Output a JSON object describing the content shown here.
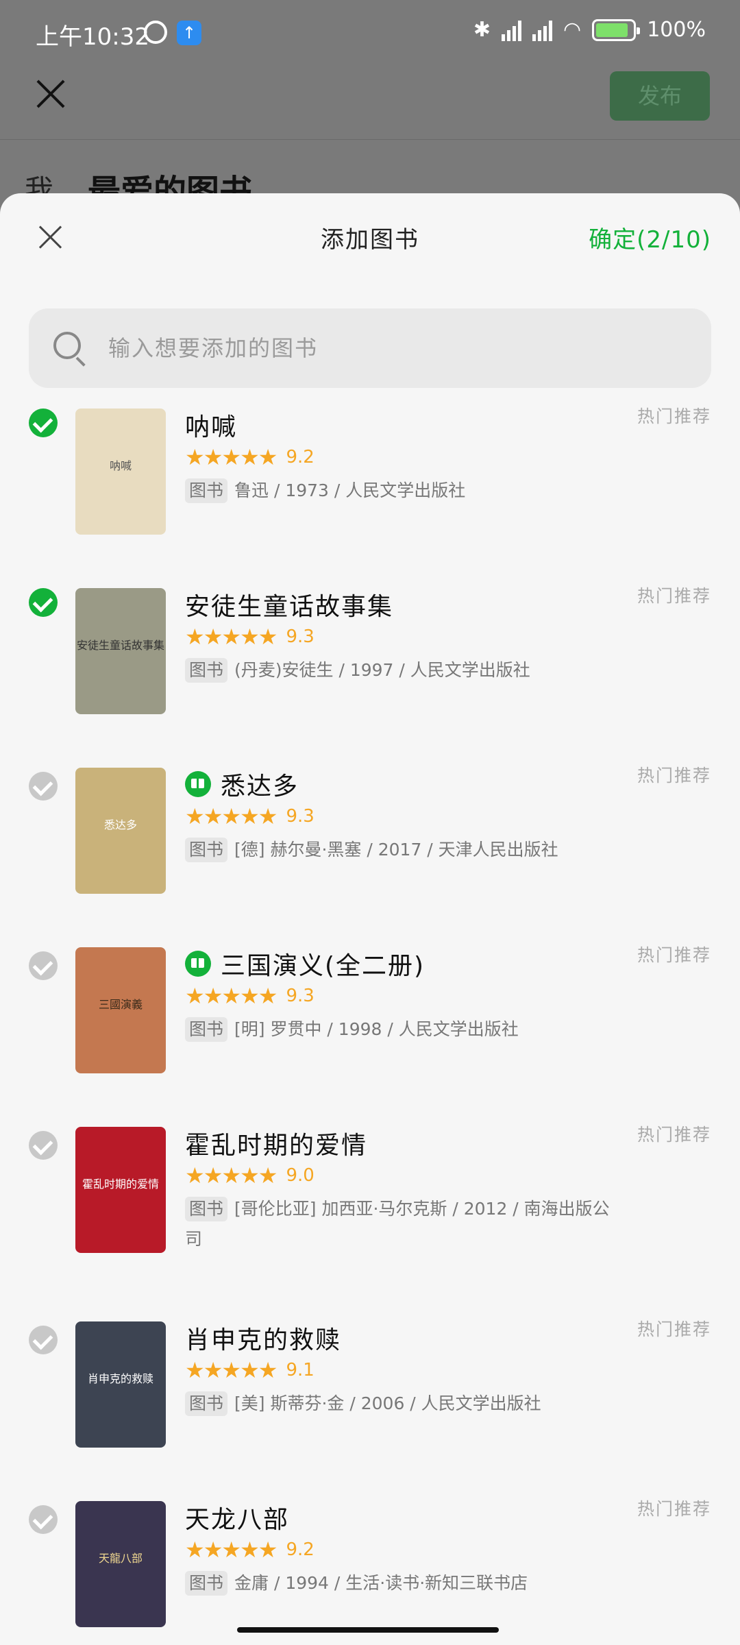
{
  "status_bar": {
    "time": "上午10:32",
    "battery": "100%"
  },
  "background_page": {
    "publish_label": "发布",
    "title": "最爱的图书",
    "title_icon": "我"
  },
  "sheet": {
    "title": "添加图书",
    "confirm_label": "确定(2/10)",
    "search_placeholder": "输入想要添加的图书"
  },
  "books": [
    {
      "title": "呐喊",
      "stars": "★★★★★",
      "rating": "9.2",
      "tag": "图书",
      "meta": "鲁迅 / 1973 / 人民文学出版社",
      "badge": "热门推荐",
      "selected": true,
      "readable": false
    },
    {
      "title": "安徒生童话故事集",
      "stars": "★★★★★",
      "rating": "9.3",
      "tag": "图书",
      "meta": "(丹麦)安徒生 / 1997 / 人民文学出版社",
      "badge": "热门推荐",
      "selected": true,
      "readable": false
    },
    {
      "title": "悉达多",
      "stars": "★★★★★",
      "rating": "9.3",
      "tag": "图书",
      "meta": "[德] 赫尔曼·黑塞 / 2017 / 天津人民出版社",
      "badge": "热门推荐",
      "selected": false,
      "readable": true
    },
    {
      "title": "三国演义(全二册)",
      "stars": "★★★★★",
      "rating": "9.3",
      "tag": "图书",
      "meta": "[明] 罗贯中 / 1998 / 人民文学出版社",
      "badge": "热门推荐",
      "selected": false,
      "readable": true
    },
    {
      "title": "霍乱时期的爱情",
      "stars": "★★★★★",
      "rating": "9.0",
      "tag": "图书",
      "meta": "[哥伦比亚] 加西亚·马尔克斯 / 2012 / 南海出版公司",
      "badge": "热门推荐",
      "selected": false,
      "readable": false
    },
    {
      "title": "肖申克的救赎",
      "stars": "★★★★★",
      "rating": "9.1",
      "tag": "图书",
      "meta": "[美] 斯蒂芬·金 / 2006 / 人民文学出版社",
      "badge": "热门推荐",
      "selected": false,
      "readable": false
    },
    {
      "title": "天龙八部",
      "stars": "★★★★★",
      "rating": "9.2",
      "tag": "图书",
      "meta": "金庸 / 1994 / 生活·读书·新知三联书店",
      "badge": "热门推荐",
      "selected": false,
      "readable": false
    }
  ],
  "covers": [
    {
      "text": "呐喊",
      "color": "#e8dcc0",
      "fg": "#555"
    },
    {
      "text": "安徒生童话故事集",
      "color": "#9a9a86",
      "fg": "#333"
    },
    {
      "text": "悉达多",
      "color": "#c9b27a",
      "fg": "#fff"
    },
    {
      "text": "三國演義",
      "color": "#c47850",
      "fg": "#3a2a1a"
    },
    {
      "text": "霍乱时期的爱情",
      "color": "#b81a28",
      "fg": "#fff"
    },
    {
      "text": "肖申克的救赎",
      "color": "#3d4452",
      "fg": "#fff"
    },
    {
      "text": "天龍八部",
      "color": "#3a3550",
      "fg": "#f0d890"
    }
  ]
}
